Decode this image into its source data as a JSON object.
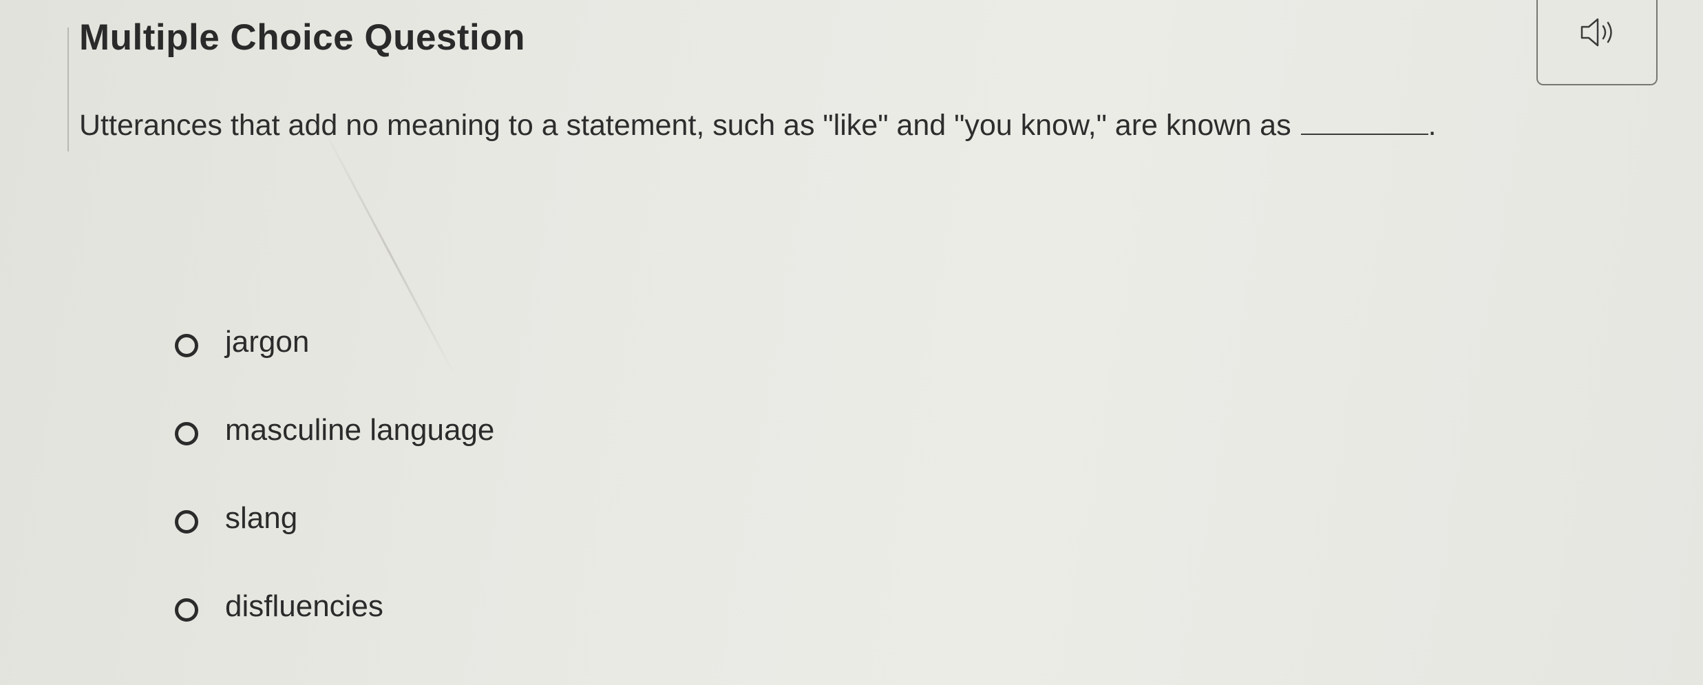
{
  "header": {
    "title": "Multiple Choice Question",
    "audio_icon": "speaker-icon"
  },
  "question": {
    "text": "Utterances that add no meaning to a statement, such as \"like\" and \"you know,\" are known as",
    "blank_suffix": "."
  },
  "options": [
    {
      "label": "jargon",
      "selected": false
    },
    {
      "label": "masculine language",
      "selected": false
    },
    {
      "label": "slang",
      "selected": false
    },
    {
      "label": "disfluencies",
      "selected": false
    }
  ]
}
